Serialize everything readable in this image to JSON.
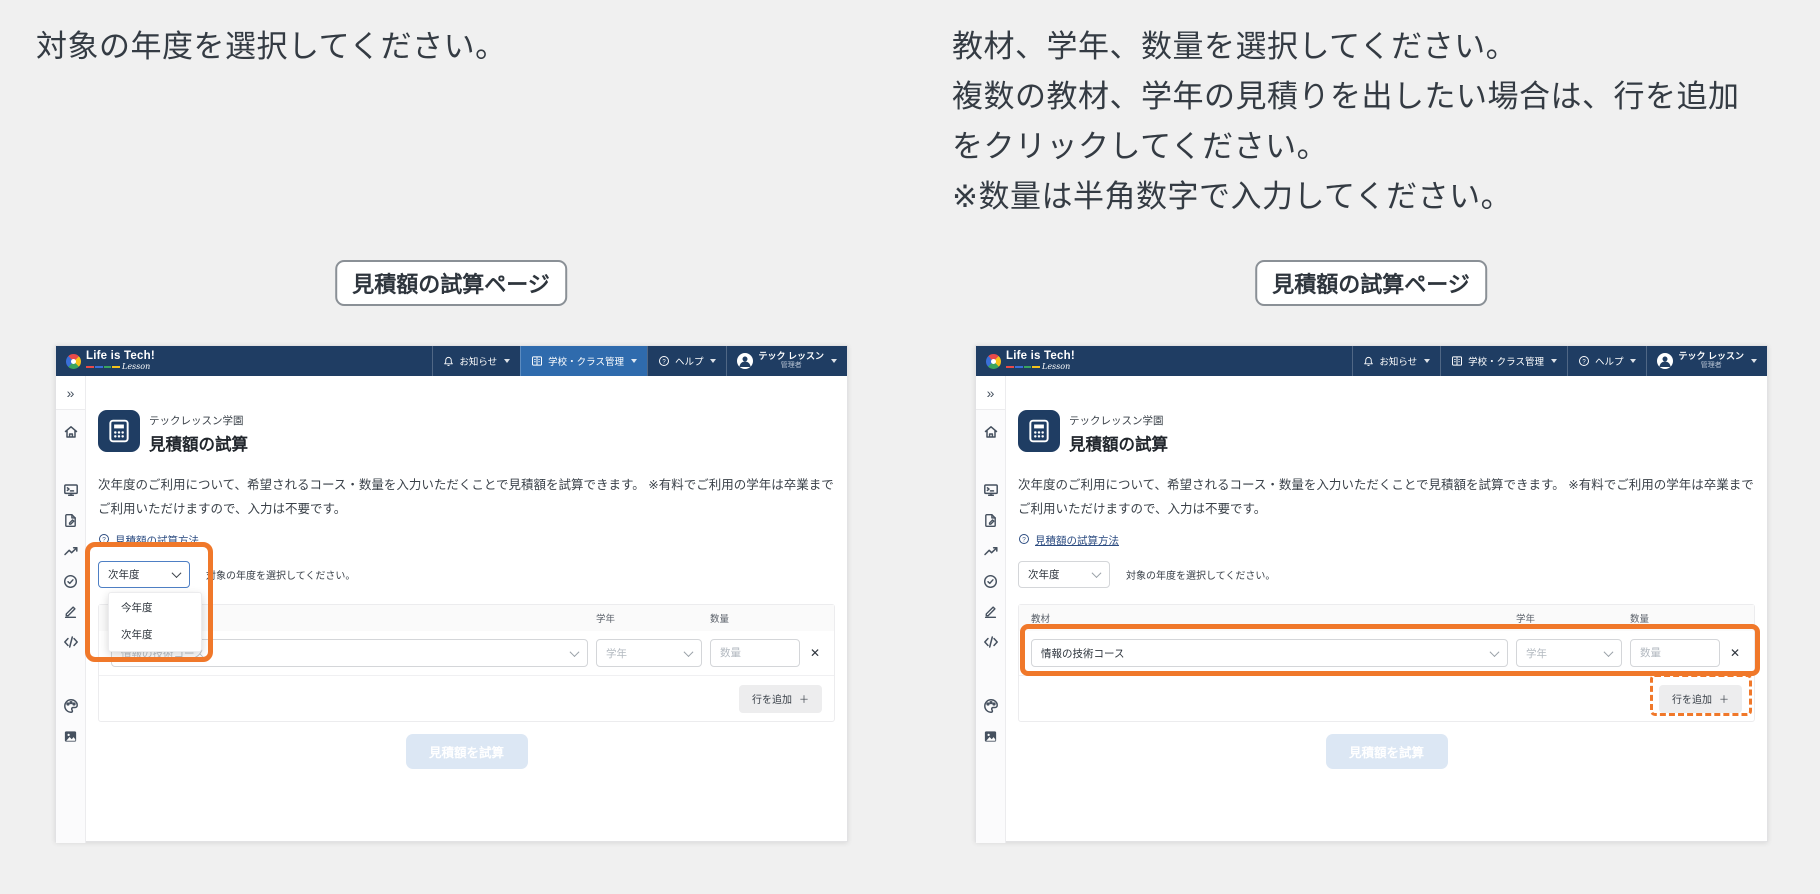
{
  "colors": {
    "orange": "#f0782a",
    "navy": "#1f3d63",
    "nav_highlight": "#2f6bad"
  },
  "instructions": {
    "left": "対象の年度を選択してください。",
    "right_p1": "教材、学年、数量を選択してください。",
    "right_p2": "複数の教材、学年の見積りを出したい場合は、行を追加をクリックしてください。",
    "right_p3": "※数量は半角数字で入力してください。"
  },
  "badge_label": "見積額の試算ページ",
  "navbar": {
    "logo_title": "Life is Tech!",
    "logo_sub": "Lesson",
    "notice_label": "お知らせ",
    "school_label": "学校・クラス管理",
    "help_label": "ヘルプ",
    "user_name": "テック レッスン",
    "user_role": "管理者"
  },
  "sidebar": {
    "collapse_icon": "»"
  },
  "main": {
    "org_name": "テックレッスン学園",
    "page_title": "見積額の試算",
    "description": "次年度のご利用について、希望されるコース・数量を入力いただくことで見積額を試算できます。 ※有料でご利用の学年は卒業までご利用いただけますので、入力は不要です。",
    "help_link": "見積額の試算方法",
    "year_select_value": "次年度",
    "year_caption": "対象の年度を選択してください。",
    "year_options": [
      "今年度",
      "次年度"
    ],
    "table": {
      "col_material": "教材",
      "col_grade": "学年",
      "col_qty": "数量",
      "material_value": "情報の技術コース",
      "grade_placeholder": "学年",
      "qty_placeholder": "数量",
      "remove_icon": "✕",
      "add_row_label": "行を追加",
      "add_row_plus": "＋",
      "submit_label": "見積額を試算"
    }
  }
}
